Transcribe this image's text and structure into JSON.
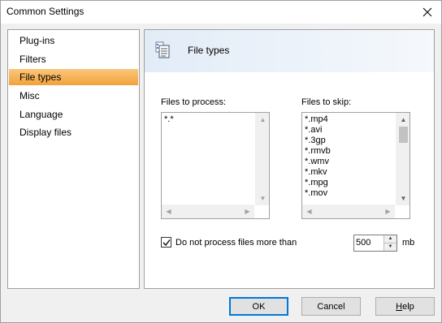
{
  "window": {
    "title": "Common Settings"
  },
  "nav": {
    "items": [
      {
        "label": "Plug-ins",
        "selected": false
      },
      {
        "label": "Filters",
        "selected": false
      },
      {
        "label": "File types",
        "selected": true
      },
      {
        "label": "Misc",
        "selected": false
      },
      {
        "label": "Language",
        "selected": false
      },
      {
        "label": "Display files",
        "selected": false
      }
    ]
  },
  "panel": {
    "title": "File types",
    "files_to_process": {
      "label": "Files to process:",
      "items": [
        "*.*"
      ]
    },
    "files_to_skip": {
      "label": "Files to skip:",
      "items": [
        "*.mp4",
        "*.avi",
        "*.3gp",
        "*.rmvb",
        "*.wmv",
        "*.mkv",
        "*.mpg",
        "*.mov"
      ]
    },
    "size_limit": {
      "checkbox_label": "Do not process files more than",
      "checked": true,
      "value": "500",
      "unit": "mb"
    }
  },
  "buttons": {
    "ok": "OK",
    "cancel": "Cancel",
    "help_prefix": "H",
    "help_rest": "elp"
  },
  "colors": {
    "selection": "#f1a13a",
    "default_button_border": "#0078d7"
  }
}
